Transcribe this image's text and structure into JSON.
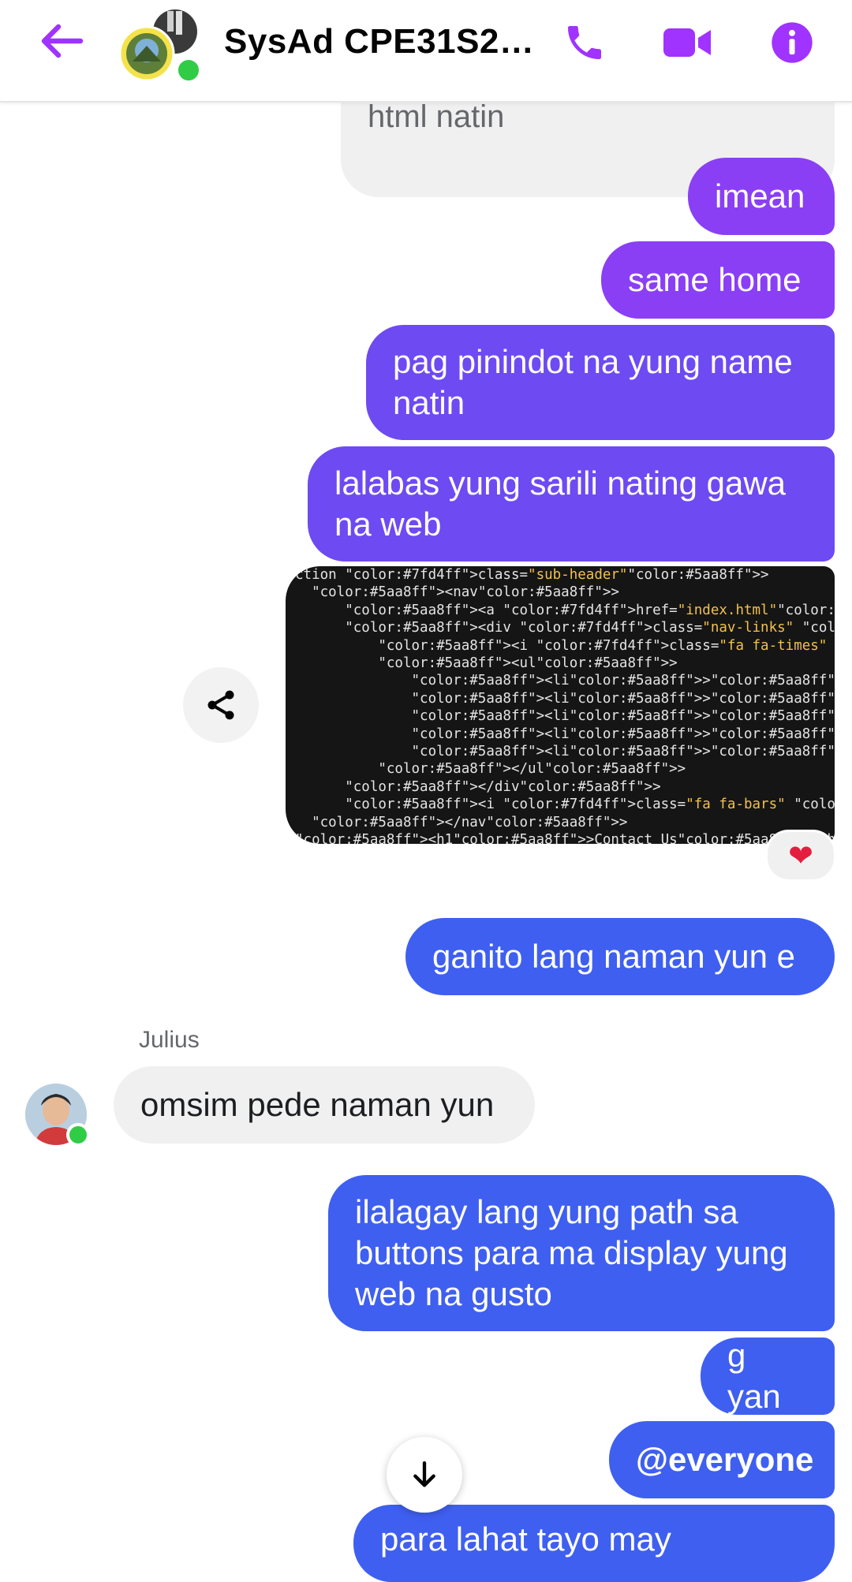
{
  "header": {
    "title": "SysAd CPE31S2 F...",
    "accent_color": "#a033ff",
    "icons": [
      "back-arrow-icon",
      "phone-icon",
      "video-camera-icon",
      "info-icon"
    ]
  },
  "messages": [
    {
      "id": "m0",
      "side": "right",
      "style": "grey",
      "text": "html natin"
    },
    {
      "id": "m1",
      "side": "right",
      "text": "imean"
    },
    {
      "id": "m2",
      "side": "right",
      "text": "same home"
    },
    {
      "id": "m3",
      "side": "right",
      "text": "pag pinindot na yung name natin"
    },
    {
      "id": "m4",
      "side": "right",
      "text": "lalabas yung sarili nating gawa na web"
    },
    {
      "id": "m5",
      "side": "right",
      "type": "image",
      "reaction": "❤"
    },
    {
      "id": "m6",
      "side": "right",
      "text": "ganito lang naman yun e"
    },
    {
      "id": "m7",
      "side": "left",
      "sender": "Julius",
      "text": "omsim pede naman yun"
    },
    {
      "id": "m8",
      "side": "right",
      "text": "ilalagay lang yung path sa buttons para ma display yung web na gusto"
    },
    {
      "id": "m9",
      "side": "right",
      "text": "g yan"
    },
    {
      "id": "m10",
      "side": "right",
      "text": "@everyone"
    },
    {
      "id": "m11",
      "side": "right",
      "text": "para lahat tayo may"
    }
  ],
  "code_image": {
    "lines": [
      "ction class=\"sub-header\">",
      "  <nav>",
      "      <a href=\"index.html\"><img src=\"images/logo.png\"></a>",
      "      <div class=\"nav-links\" id=\"navLinks\">",
      "          <i class=\"fa fa-times\" onclick=\"hideMenu()\"></i>",
      "          <ul>",
      "              <li><a href=\"index.html\">HOME</a></li>",
      "              <li><a href=\"about.html\">ABOUT</a></li>",
      "              <li><a href=\"course.html\">COURSE</a></li>",
      "              <li><a href=\"blog.html\">BLOG</a></li>",
      "              <li><a href=\"contact.html\">CONTACT</a></li>",
      "          </ul>",
      "      </div>",
      "      <i class=\"fa fa-bars\" onclick=\"showMenu()\"></i>",
      "  </nav>",
      "<h1>Contact Us</h1>"
    ]
  },
  "colors": {
    "bubble_purple": "#8a3ff5",
    "bubble_violet": "#6e4af2",
    "bubble_blue": "#3f5ff0",
    "bubble_grey": "#f0f0f0",
    "online": "#31cc46",
    "reaction": "#e41e3f"
  }
}
